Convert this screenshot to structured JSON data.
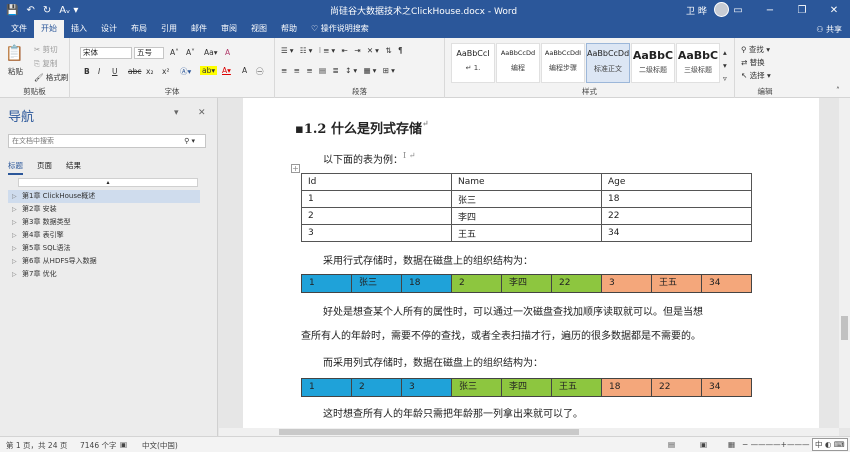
{
  "window": {
    "doc_title": "尚硅谷大数据技术之ClickHouse.docx - Word",
    "user": "卫 晔",
    "minimize": "−",
    "restore": "❐",
    "close": "✕"
  },
  "quick_access": {
    "save": "💾",
    "undo": "↶",
    "redo": "↻",
    "customize": "Aᵥ ▾"
  },
  "ribbon_tabs": [
    "文件",
    "开始",
    "插入",
    "设计",
    "布局",
    "引用",
    "邮件",
    "审阅",
    "视图",
    "帮助",
    "操作说明搜索"
  ],
  "share_label": "共享",
  "clipboard": {
    "paste": "粘贴",
    "cut": "剪切",
    "copy": "复制",
    "format_painter": "格式刷",
    "label": "剪贴板"
  },
  "font": {
    "name": "宋体",
    "size": "五号",
    "grow": "A˄",
    "shrink": "A˅",
    "change_case": "Aa▾",
    "clear": "A",
    "label": "字体",
    "bold": "B",
    "italic": "I",
    "underline": "U",
    "strike": "abc",
    "sub": "x₂",
    "sup": "x²"
  },
  "paragraph": {
    "label": "段落"
  },
  "styles": {
    "items": [
      {
        "sample": "AaBbCcI",
        "name": "↵ 1."
      },
      {
        "sample": "AaBbCcDd",
        "name": "编程"
      },
      {
        "sample": "AaBbCcDdI",
        "name": "编程步骤"
      },
      {
        "sample": "AaBbCcDd",
        "name": "标准正文"
      },
      {
        "sample": "AaBbC",
        "name": "二级标题"
      },
      {
        "sample": "AaBbC",
        "name": "三级标题"
      }
    ],
    "label": "样式"
  },
  "editing": {
    "find": "查找 ▾",
    "replace": "替换",
    "select": "选择 ▾",
    "label": "编辑"
  },
  "nav": {
    "title": "导航",
    "search_placeholder": "在文档中搜索",
    "tabs": [
      "标题",
      "页面",
      "结果"
    ],
    "items": [
      "第1章 ClickHouse概述",
      "第2章 安装",
      "第3章 数据类型",
      "第4章 表引擎",
      "第5章 SQL语法",
      "第6章 从HDFS导入数据",
      "第7章 优化"
    ],
    "selected": 0
  },
  "doc": {
    "heading": "1.2  什么是列式存储",
    "p_example": "以下面的表为例：",
    "table": [
      [
        "Id",
        "Name",
        "Age"
      ],
      [
        "1",
        "张三",
        "18"
      ],
      [
        "2",
        "李四",
        "22"
      ],
      [
        "3",
        "王五",
        "34"
      ]
    ],
    "p_row": "采用行式存储时，数据在磁盘上的组织结构为：",
    "row_strip": [
      "1",
      "张三",
      "18",
      "2",
      "李四",
      "22",
      "3",
      "王五",
      "34"
    ],
    "p_pro1": "好处是想查某个人所有的属性时，可以通过一次磁盘查找加顺序读取就可以。但是当想",
    "p_pro2": "查所有人的年龄时，需要不停的查找，或者全表扫描才行，遍历的很多数据都是不需要的。",
    "p_col": "而采用列式存储时，数据在磁盘上的组织结构为：",
    "col_strip": [
      "1",
      "2",
      "3",
      "张三",
      "李四",
      "王五",
      "18",
      "22",
      "34"
    ],
    "p_end": "这时想查所有人的年龄只需把年龄那一列拿出来就可以了。"
  },
  "status": {
    "page": "第 1 页，共 24 页",
    "words": "7146 个字",
    "lang": "中文(中国)",
    "zoom": "−  ————+———  +",
    "ime": "中 ◐ ⌨"
  },
  "colors": {
    "blue": "#1fa2d9",
    "green": "#8dc63f",
    "orange": "#f4a77b",
    "brand": "#2b579a"
  }
}
